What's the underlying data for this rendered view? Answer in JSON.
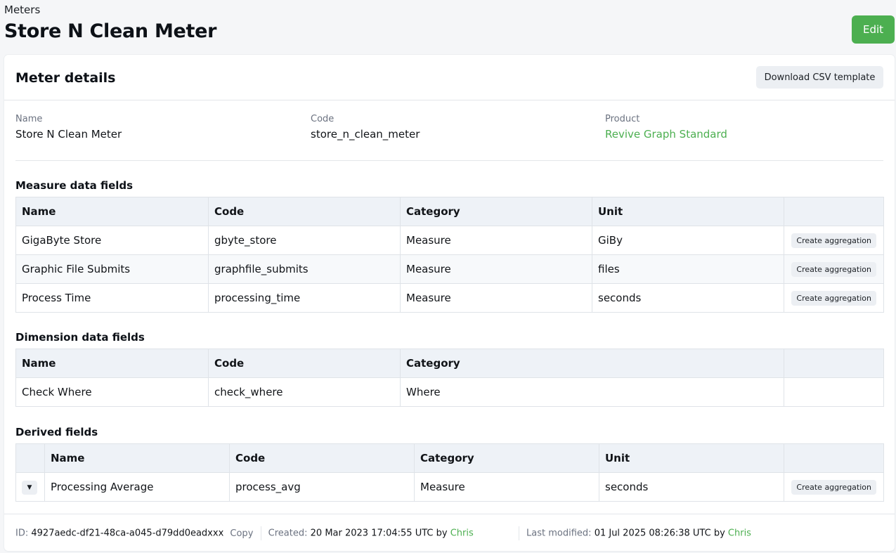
{
  "breadcrumb": "Meters",
  "title": "Store N Clean Meter",
  "edit_label": "Edit",
  "card": {
    "title": "Meter details",
    "download_label": "Download CSV template"
  },
  "details": {
    "name_label": "Name",
    "name_value": "Store N Clean Meter",
    "code_label": "Code",
    "code_value": "store_n_clean_meter",
    "product_label": "Product",
    "product_value": "Revive Graph Standard"
  },
  "measure": {
    "title": "Measure data fields",
    "headers": [
      "Name",
      "Code",
      "Category",
      "Unit"
    ],
    "action_label": "Create aggregation",
    "rows": [
      {
        "name": "GigaByte Store",
        "code": "gbyte_store",
        "category": "Measure",
        "unit": "GiBy"
      },
      {
        "name": "Graphic File Submits",
        "code": "graphfile_submits",
        "category": "Measure",
        "unit": "files"
      },
      {
        "name": "Process Time",
        "code": "processing_time",
        "category": "Measure",
        "unit": "seconds"
      }
    ]
  },
  "dimension": {
    "title": "Dimension data fields",
    "headers": [
      "Name",
      "Code",
      "Category"
    ],
    "rows": [
      {
        "name": "Check Where",
        "code": "check_where",
        "category": "Where"
      }
    ]
  },
  "derived": {
    "title": "Derived fields",
    "headers": [
      "Name",
      "Code",
      "Category",
      "Unit"
    ],
    "action_label": "Create aggregation",
    "rows": [
      {
        "name": "Processing Average",
        "code": "process_avg",
        "category": "Measure",
        "unit": "seconds"
      }
    ]
  },
  "footer": {
    "id_label": "ID:",
    "id_value": "4927aedc-df21-48ca-a045-d79dd0eadxxx",
    "copy_label": "Copy",
    "created_label": "Created:",
    "created_value": "20 Mar 2023 17:04:55 UTC by",
    "created_by": "Chris",
    "modified_label": "Last modified:",
    "modified_value": "01 Jul 2025 08:26:38 UTC by",
    "modified_by": "Chris"
  },
  "colors": {
    "accent": "#4caf50",
    "header_bg": "#eef2f7"
  }
}
